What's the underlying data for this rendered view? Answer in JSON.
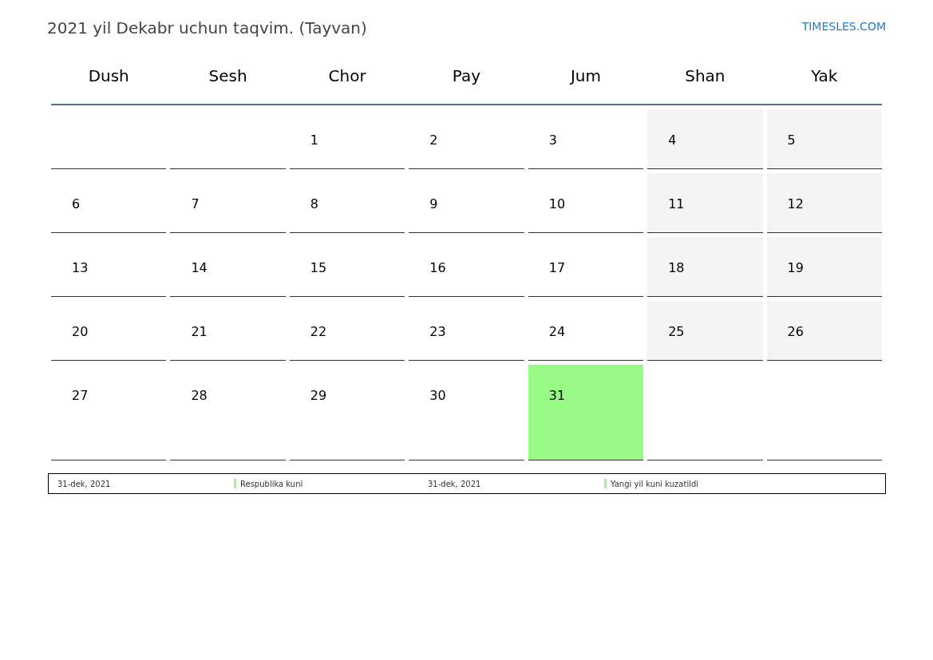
{
  "title": "2021 yil Dekabr uchun taqvim. (Tayvan)",
  "site_link": "TIMESLES.COM",
  "weekdays": [
    "Dush",
    "Sesh",
    "Chor",
    "Pay",
    "Jum",
    "Shan",
    "Yak"
  ],
  "weeks": [
    [
      {
        "kind": "empty"
      },
      {
        "kind": "empty"
      },
      {
        "kind": "weekday",
        "text": "1"
      },
      {
        "kind": "weekday",
        "text": "2"
      },
      {
        "kind": "weekday",
        "text": "3"
      },
      {
        "kind": "weekend",
        "text": "4"
      },
      {
        "kind": "weekend",
        "text": "5"
      }
    ],
    [
      {
        "kind": "weekday",
        "text": "6"
      },
      {
        "kind": "weekday",
        "text": "7"
      },
      {
        "kind": "weekday",
        "text": "8"
      },
      {
        "kind": "weekday",
        "text": "9"
      },
      {
        "kind": "weekday",
        "text": "10"
      },
      {
        "kind": "weekend",
        "text": "11"
      },
      {
        "kind": "weekend",
        "text": "12"
      }
    ],
    [
      {
        "kind": "weekday",
        "text": "13"
      },
      {
        "kind": "weekday",
        "text": "14"
      },
      {
        "kind": "weekday",
        "text": "15"
      },
      {
        "kind": "weekday",
        "text": "16"
      },
      {
        "kind": "weekday",
        "text": "17"
      },
      {
        "kind": "weekend",
        "text": "18"
      },
      {
        "kind": "weekend",
        "text": "19"
      }
    ],
    [
      {
        "kind": "weekday",
        "text": "20"
      },
      {
        "kind": "weekday",
        "text": "21"
      },
      {
        "kind": "weekday",
        "text": "22"
      },
      {
        "kind": "weekday",
        "text": "23"
      },
      {
        "kind": "weekday",
        "text": "24"
      },
      {
        "kind": "weekend",
        "text": "25"
      },
      {
        "kind": "weekend",
        "text": "26"
      }
    ],
    [
      {
        "kind": "weekday",
        "text": "27"
      },
      {
        "kind": "weekday",
        "text": "28"
      },
      {
        "kind": "weekday",
        "text": "29"
      },
      {
        "kind": "weekday",
        "text": "30"
      },
      {
        "kind": "holiday",
        "text": "31"
      },
      {
        "kind": "empty"
      },
      {
        "kind": "empty"
      }
    ]
  ],
  "legend": [
    {
      "date": "31-dek, 2021",
      "name": "Respublika kuni",
      "color": "#99fa88"
    },
    {
      "date": "31-dek, 2021",
      "name": "Yangi yil kuni kuzatildi",
      "color": "#99fa88"
    }
  ]
}
